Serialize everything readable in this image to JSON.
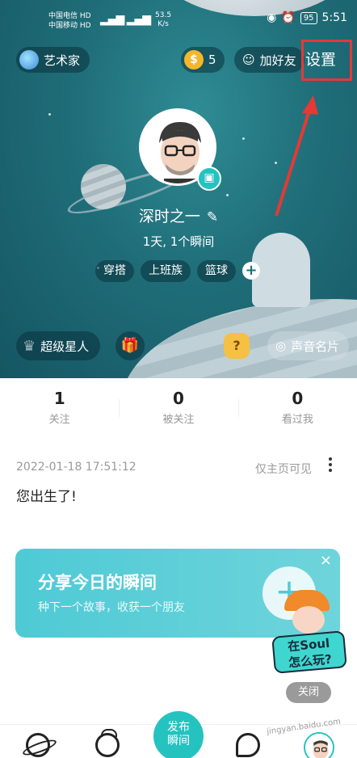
{
  "status_bar": {
    "carrier_1": "中国电信",
    "carrier_1_badge": "HD",
    "carrier_2": "中国移动",
    "carrier_2_badge": "HD",
    "net_speed": "53.5",
    "net_speed_unit": "K/s",
    "battery": "95",
    "time": "5:51"
  },
  "header": {
    "role_label": "艺术家",
    "coin_count": "5",
    "add_friend_label": "加好友",
    "settings_label": "设置"
  },
  "profile": {
    "nickname": "深时之一",
    "summary": "1天, 1个瞬间",
    "tags": [
      "穿搭",
      "上班族",
      "篮球"
    ],
    "tag_add": "+"
  },
  "actions": {
    "super_star_label": "超级星人",
    "voice_card_label": "声音名片"
  },
  "stats": [
    {
      "value": "1",
      "label": "关注"
    },
    {
      "value": "0",
      "label": "被关注"
    },
    {
      "value": "0",
      "label": "看过我"
    }
  ],
  "moment": {
    "date": "2022-01-18 17:51:12",
    "visibility": "仅主页可见",
    "text": "您出生了!"
  },
  "share_banner": {
    "title": "分享今日的瞬间",
    "subtitle": "种下一个故事，收获一个朋友",
    "close": "×",
    "plus": "+"
  },
  "help_bubble": {
    "line1": "在Soul",
    "line2": "怎么玩?",
    "close_label": "关闭"
  },
  "tabbar": {
    "publish_line1": "发布",
    "publish_line2": "瞬间"
  },
  "watermark": "jingyan.baidu.com",
  "colors": {
    "accent": "#25c3c0",
    "hero_bg": "#1f6d78",
    "highlight_box": "#e53935"
  }
}
